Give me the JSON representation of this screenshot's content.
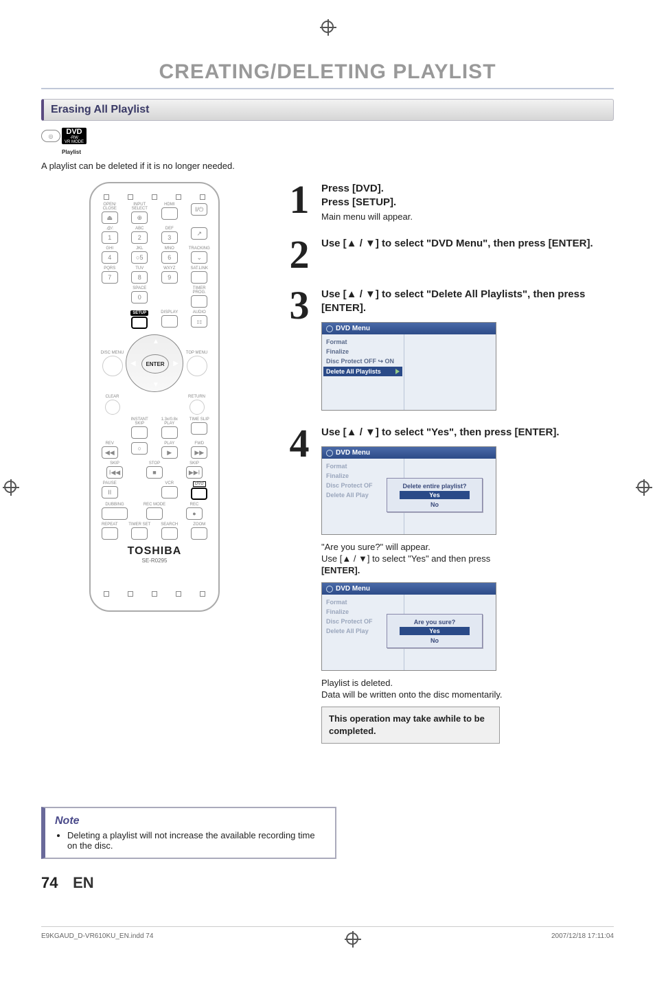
{
  "page_title": "CREATING/DELETING PLAYLIST",
  "section_title": "Erasing All Playlist",
  "dvd_badge": {
    "logo": "DVD",
    "sub1": "-RW",
    "sub2": "VR MODE",
    "caption": "Playlist"
  },
  "intro": "A playlist can be deleted if it is no longer needed.",
  "remote": {
    "row_open": [
      "OPEN/\nCLOSE",
      "INPUT\nSELECT",
      "HDMI",
      ""
    ],
    "btn_open": [
      "⏏",
      "⊕",
      "",
      "I/⏻"
    ],
    "row_abc": [
      ".@/:",
      "ABC",
      "DEF",
      ""
    ],
    "btn_123": [
      "1",
      "2",
      "3",
      "↗"
    ],
    "row_ghi": [
      "GHI",
      "JKL",
      "MNO",
      "TRACKING"
    ],
    "btn_456": [
      "4",
      "○5",
      "6",
      "⌄"
    ],
    "row_pqrs": [
      "PQRS",
      "TUV",
      "WXYZ",
      "SAT.LINK"
    ],
    "btn_789": [
      "7",
      "8",
      "9",
      ""
    ],
    "row_space": [
      "",
      "SPACE",
      "",
      "TIMER\nPROG."
    ],
    "btn_0": [
      "",
      "0",
      "",
      ""
    ],
    "row_setup": [
      "",
      "SETUP",
      "DISPLAY",
      "AUDIO"
    ],
    "btn_setup": [
      "",
      "",
      "",
      "⚏"
    ],
    "disc_menu": "DISC MENU",
    "top_menu": "TOP MENU",
    "enter": "ENTER",
    "clear": "CLEAR",
    "return": "RETURN",
    "row_instant": [
      "",
      "INSTANT\nSKIP",
      "1.3x/0.8x\nPLAY",
      "TIME SLIP"
    ],
    "row_rev": [
      "REV",
      "",
      "PLAY",
      "",
      "FWD"
    ],
    "btn_rev": [
      "◀◀",
      "○",
      "▶",
      "▶▶"
    ],
    "row_skip": [
      "SKIP",
      "",
      "STOP",
      "",
      "SKIP"
    ],
    "btn_skip": [
      "I◀◀",
      "",
      "■",
      "",
      "▶▶I"
    ],
    "row_pause": [
      "PAUSE",
      "",
      "",
      "VCR",
      "DVD"
    ],
    "btn_pause": [
      "II",
      "",
      "",
      "",
      ""
    ],
    "row_dub": [
      "DUBBING",
      "",
      "REC MODE",
      "REC"
    ],
    "btn_dub": [
      "",
      "",
      "",
      "●"
    ],
    "row_rep": [
      "REPEAT",
      "TIMER SET",
      "SEARCH",
      "ZOOM"
    ],
    "brand": "TOSHIBA",
    "model": "SE-R0295"
  },
  "steps": [
    {
      "n": "1",
      "lines": [
        "Press [DVD].",
        "Press [SETUP]."
      ],
      "sub": "Main menu will appear."
    },
    {
      "n": "2",
      "lines": [
        "Use [▲ / ▼] to select \"DVD Menu\", then press [ENTER]."
      ]
    },
    {
      "n": "3",
      "lines": [
        "Use [▲ / ▼] to select \"Delete All Playlists\", then press [ENTER]."
      ],
      "osd": {
        "title": "DVD Menu",
        "items": [
          "Format",
          "Finalize",
          "Disc Protect OFF ↪ ON"
        ],
        "selected": "Delete All Playlists"
      }
    },
    {
      "n": "4",
      "lines": [
        "Use [▲ / ▼] to select \"Yes\", then press [ENTER]."
      ],
      "osd1": {
        "title": "DVD Menu",
        "items": [
          "Format",
          "Finalize",
          "Disc Protect OF",
          "Delete All Play"
        ],
        "dialog": {
          "q": "Delete entire playlist?",
          "opts": [
            "Yes",
            "No"
          ],
          "sel": 0
        }
      },
      "mid1": "\"Are you sure?\" will appear.",
      "mid2": "Use [▲ / ▼] to select \"Yes\" and then press",
      "mid3": "[ENTER].",
      "osd2": {
        "title": "DVD Menu",
        "items": [
          "Format",
          "Finalize",
          "Disc Protect OF",
          "Delete All Play"
        ],
        "dialog": {
          "q": "Are you sure?",
          "opts": [
            "Yes",
            "No"
          ],
          "sel": 0
        }
      },
      "tail1": "Playlist is deleted.",
      "tail2": "Data will be written onto the disc momentarily.",
      "boxed": "This operation may take awhile to be completed."
    }
  ],
  "note": {
    "heading": "Note",
    "bullet": "Deleting a playlist will not increase the available recording time on the disc."
  },
  "footer": {
    "page": "74",
    "lang": "EN",
    "file": "E9KGAUD_D-VR610KU_EN.indd   74",
    "timestamp": "2007/12/18   17:11:04"
  }
}
